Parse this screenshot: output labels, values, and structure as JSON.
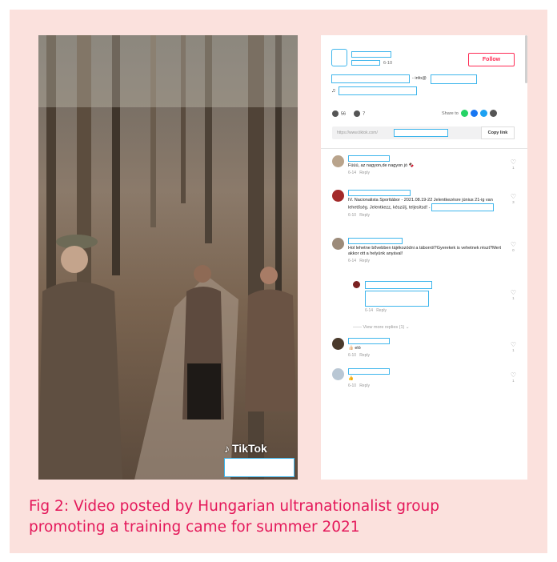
{
  "video": {
    "watermark": "TikTok"
  },
  "panel": {
    "follow_label": "Follow",
    "date_fragment": "6-10",
    "bio_fragment": "- info@",
    "music_icon": "music-note-icon",
    "likes": "56",
    "comments": "7",
    "share_label": "Share to",
    "share_colors": [
      "#25d366",
      "#1877f2",
      "#1da1f2",
      "#555555"
    ],
    "url_text": "https://www.tiktok.com/",
    "copy_link": "Copy link",
    "accent": "#fe2c55"
  },
  "comments": [
    {
      "text": "Fúúú, az nagyon,de nagyon jó 🍫",
      "date": "6-14",
      "reply": "Reply",
      "likes": "1",
      "avatar_color": "#b9a48c"
    },
    {
      "text": "IV. Nacionalista Sporttábor - 2021.08.19-22 Jelentkezésre június 21-ig van lehetőség. Jelentkezz, készülj, teljesítsd! -",
      "date": "6-10",
      "reply": "Reply",
      "likes": "3",
      "avatar_color": "#a32a2a"
    },
    {
      "text": "Hol lehetne bővebben tájékozódni a táborról?Gyerekek is vehetnek részt?Mert akkor ott a helyünk anyával!",
      "date": "6-14",
      "reply": "Reply",
      "likes": "0",
      "avatar_color": "#9c8b7a"
    },
    {
      "text": "",
      "date": "6-14",
      "reply": "Reply",
      "likes": "1",
      "avatar_color": "#7a2222"
    },
    {
      "text": "👍🏻 eló",
      "date": "6-10",
      "reply": "Reply",
      "likes": "1",
      "avatar_color": "#4a3a2c"
    },
    {
      "text": "👍",
      "date": "6-10",
      "reply": "Reply",
      "likes": "1",
      "avatar_color": "#b9c7d4"
    }
  ],
  "view_more": "View more replies (1)",
  "caption": {
    "line1": "Fig 2: Video posted by Hungarian ultranationalist group",
    "line2": "promoting a training came for summer 2021"
  }
}
